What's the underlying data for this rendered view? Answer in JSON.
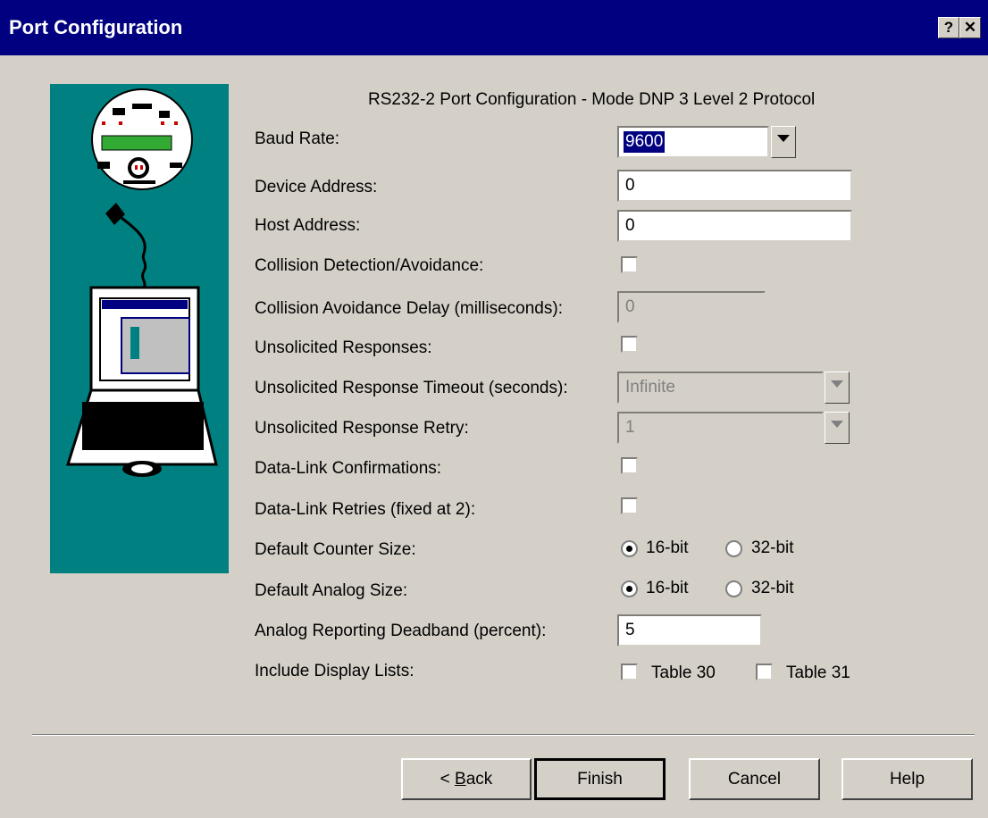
{
  "window": {
    "title": "Port Configuration",
    "help_glyph": "?",
    "close_glyph": "✕"
  },
  "header": {
    "subtitle": "RS232-2 Port Configuration - Mode DNP 3 Level 2 Protocol"
  },
  "form": {
    "baud_rate": {
      "label": "Baud Rate:",
      "value": "9600"
    },
    "device_address": {
      "label": "Device Address:",
      "value": "0"
    },
    "host_address": {
      "label": "Host Address:",
      "value": "0"
    },
    "collision_detection": {
      "label": "Collision Detection/Avoidance:",
      "checked": false
    },
    "collision_delay": {
      "label": "Collision Avoidance Delay (milliseconds):",
      "value": "0",
      "enabled": false
    },
    "unsolicited_responses": {
      "label": "Unsolicited Responses:",
      "checked": false
    },
    "unsolicited_timeout": {
      "label": "Unsolicited Response Timeout (seconds):",
      "value": "Infinite",
      "enabled": false
    },
    "unsolicited_retry": {
      "label": "Unsolicited Response Retry:",
      "value": "1",
      "enabled": false
    },
    "datalink_confirmations": {
      "label": "Data-Link Confirmations:",
      "checked": false
    },
    "datalink_retries": {
      "label": "Data-Link Retries (fixed at 2):",
      "checked": false
    },
    "counter_size": {
      "label": "Default Counter Size:",
      "options": [
        "16-bit",
        "32-bit"
      ],
      "selected": "16-bit"
    },
    "analog_size": {
      "label": "Default Analog Size:",
      "options": [
        "16-bit",
        "32-bit"
      ],
      "selected": "16-bit"
    },
    "analog_deadband": {
      "label": "Analog Reporting Deadband (percent):",
      "value": "5"
    },
    "display_lists": {
      "label": "Include Display Lists:",
      "options": [
        "Table 30",
        "Table 31"
      ],
      "checked": [
        false,
        false
      ]
    }
  },
  "buttons": {
    "back_mnemonic": "B",
    "back_rest": "ack",
    "back_prefix": "< ",
    "finish": "Finish",
    "cancel": "Cancel",
    "help": "Help"
  },
  "illustration": {
    "icons": [
      "meter-icon",
      "cable-icon",
      "laptop-icon"
    ]
  },
  "colors": {
    "titlebar": "#000080",
    "panel": "#008080",
    "dialog": "#d4d0c8"
  }
}
